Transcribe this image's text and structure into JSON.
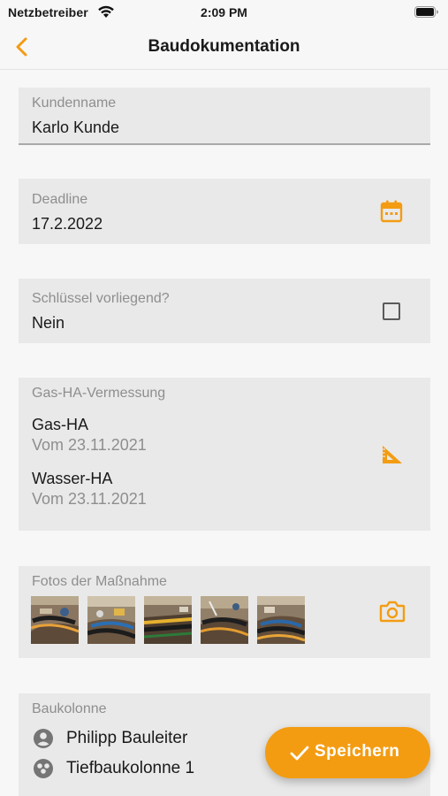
{
  "status_bar": {
    "carrier": "Netzbetreiber",
    "time": "2:09 PM",
    "wifi_icon": "wifi-icon",
    "battery_icon": "battery-icon"
  },
  "nav": {
    "title": "Baudokumentation",
    "back_icon": "chevron-left-icon"
  },
  "customer": {
    "label": "Kundenname",
    "value": "Karlo Kunde"
  },
  "deadline": {
    "label": "Deadline",
    "value": "17.2.2022",
    "icon": "calendar-icon"
  },
  "keys": {
    "label": "Schlüssel vorliegend?",
    "value": "Nein",
    "checked": false
  },
  "survey": {
    "label": "Gas-HA-Vermessung",
    "items": [
      {
        "title": "Gas-HA",
        "date": "Vom 23.11.2021"
      },
      {
        "title": "Wasser-HA",
        "date": "Vom 23.11.2021"
      }
    ],
    "icon": "set-square-icon"
  },
  "photos": {
    "label": "Fotos der Maßnahme",
    "count": 5,
    "icon": "camera-icon"
  },
  "crew": {
    "label": "Baukolonne",
    "members": [
      {
        "name": "Philipp Bauleiter",
        "icon": "person-icon"
      },
      {
        "name": "Tiefbaukolonne 1",
        "icon": "team-icon"
      }
    ]
  },
  "fab": {
    "label": "Speichern",
    "icon": "checkmark-icon"
  },
  "colors": {
    "accent": "#f39c12",
    "card_background": "#e9e9e9",
    "page_background": "#f7f7f7"
  }
}
